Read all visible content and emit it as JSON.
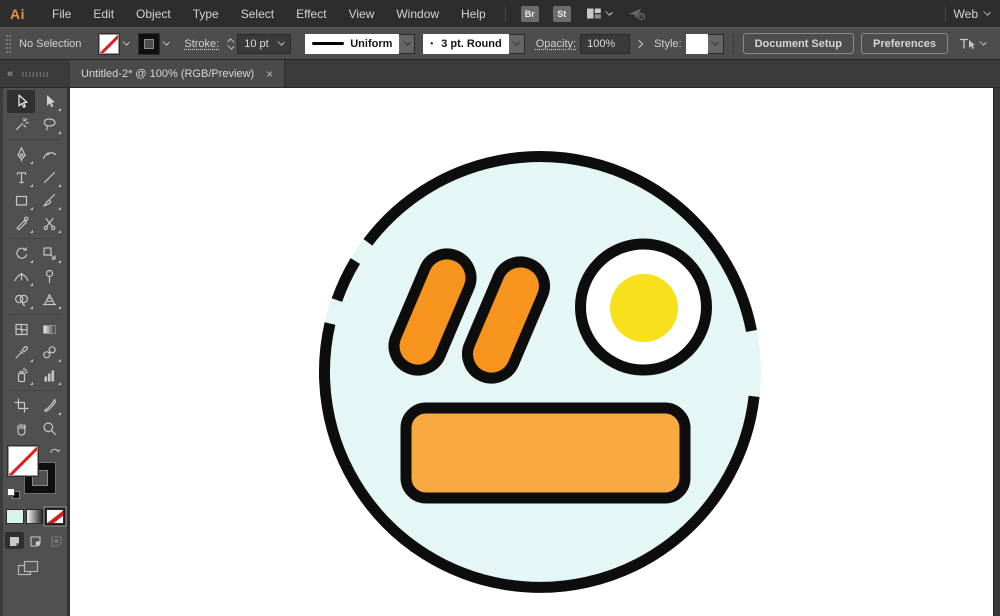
{
  "ui": {
    "colors": {
      "menubar_bg": "#2D2D2D",
      "controlbar_bg": "#4D4D4D",
      "tabbar_bg": "#3B3B3B",
      "tab_bg": "#4A4A4A",
      "panel_bg": "#505050",
      "field_bg": "#3A3A3A",
      "text": "#D4D4D4",
      "logo_orange": "#E8913F",
      "none_slash_red": "#E02020"
    }
  },
  "menubar": {
    "logo": "Ai",
    "items": [
      "File",
      "Edit",
      "Object",
      "Type",
      "Select",
      "Effect",
      "View",
      "Window",
      "Help"
    ],
    "bridge": "Br",
    "stock": "St",
    "workspace": "Web"
  },
  "controlbar": {
    "selection_status": "No Selection",
    "stroke_label": "Stroke:",
    "stroke_weight": "10 pt",
    "profile_value": "Uniform",
    "brush_dot": "•",
    "brush_value": "3 pt. Round",
    "opacity_label": "Opacity:",
    "opacity_value": "100%",
    "style_label": "Style:",
    "document_setup": "Document Setup",
    "preferences": "Preferences"
  },
  "tabbar": {
    "title": "Untitled-2* @ 100% (RGB/Preview)",
    "close_glyph": "×"
  },
  "toolbar": {
    "collapse_glyph": "«",
    "selected_tool": "selection",
    "tools": [
      "selection",
      "direct-selection",
      "magic-wand",
      "lasso",
      "pen",
      "curvature",
      "type",
      "line-segment",
      "rectangle",
      "paintbrush",
      "shaper",
      "scissors",
      "rotate",
      "scale",
      "width",
      "puppet-warp",
      "shape-builder",
      "perspective-grid",
      "mesh",
      "gradient",
      "eyedropper",
      "blend",
      "symbol-sprayer",
      "column-graph",
      "artboard",
      "slice",
      "hand",
      "zoom"
    ]
  },
  "artwork": {
    "colors": {
      "canvas": "#FFFFFF",
      "plate_fill": "#E4F7F5",
      "outline": "#0D0D0D",
      "sausage": "#F7941E",
      "bread": "#F9A942",
      "egg_white": "#FFFFFF",
      "egg_yolk": "#F8E11A"
    }
  }
}
